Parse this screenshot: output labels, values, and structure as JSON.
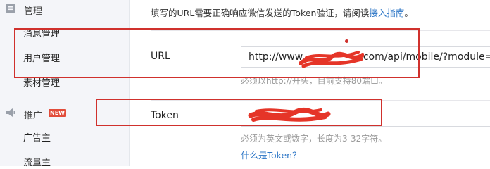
{
  "sidebar": {
    "manage_section": "管理",
    "manage_items": [
      "消息管理",
      "用户管理",
      "素材管理"
    ],
    "promote_section": "推广",
    "new_badge": "NEW",
    "promote_items": [
      "广告主",
      "流量主"
    ]
  },
  "notice": {
    "text": "填写的URL需要正确响应微信发送的Token验证，请阅读",
    "link": "接入指南",
    "suffix": "。"
  },
  "url_field": {
    "label": "URL",
    "value": "http://www.",
    "value_tail": ".com/api/mobile/?module=we",
    "hint": "必须以http://开头，目前支持80端口。"
  },
  "token_field": {
    "label": "Token",
    "hint": "必须为英文或数字，长度为3-32字符。",
    "help_link": "什么是Token？"
  },
  "colors": {
    "annotation_red": "#d0312d",
    "link_blue": "#2b75c6",
    "sidebar_bg": "#f4f5f9"
  }
}
